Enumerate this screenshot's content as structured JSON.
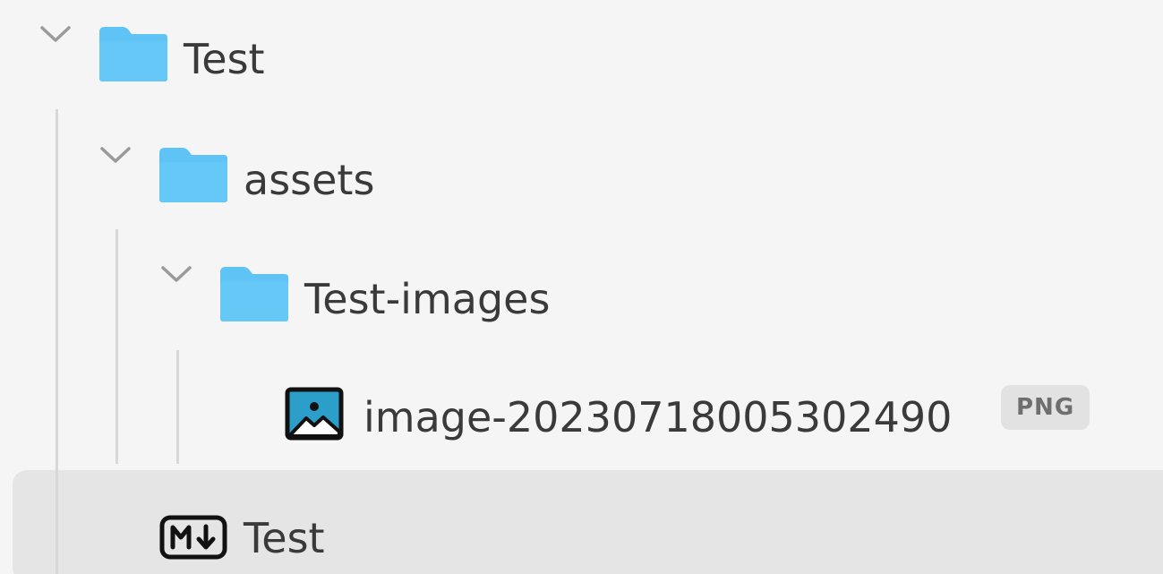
{
  "tree": {
    "root": {
      "label": "Test",
      "icon": "folder-icon",
      "expanded": true
    },
    "assets": {
      "label": "assets",
      "icon": "folder-icon",
      "expanded": true
    },
    "images_folder": {
      "label": "Test-images",
      "icon": "folder-icon",
      "expanded": true
    },
    "image_file": {
      "label": "image-20230718005302490",
      "icon": "image-file-icon",
      "badge": "PNG"
    },
    "md_file": {
      "label": "Test",
      "icon": "markdown-icon",
      "selected": true
    }
  },
  "colors": {
    "background": "#f5f5f5",
    "selected_row": "#e5e5e5",
    "folder": "#5fc4f5",
    "text": "#3a3a3a",
    "guide": "#d8d8d8",
    "badge_bg": "#e2e2e2",
    "badge_text": "#6e6e6e",
    "image_icon_fill": "#2b9ec9"
  }
}
